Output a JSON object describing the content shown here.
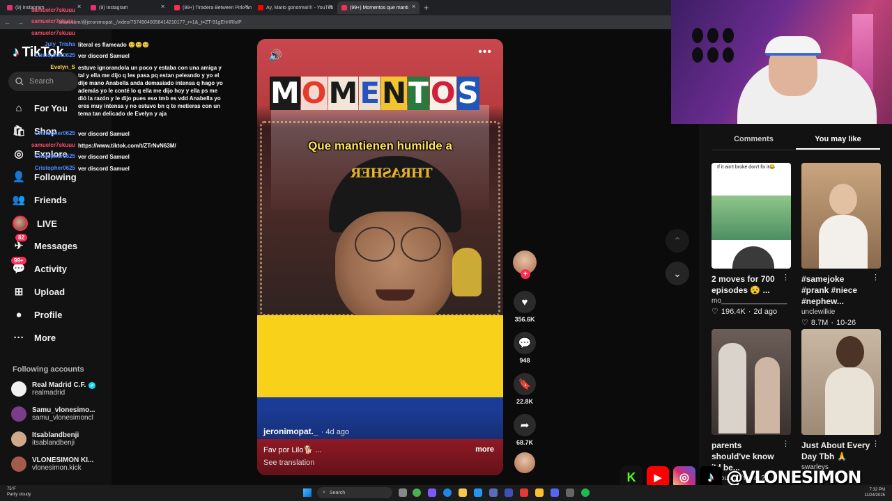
{
  "browser": {
    "tabs": [
      {
        "label": "(9) Instagram",
        "active": false,
        "color": "#e1306c"
      },
      {
        "label": "(9) Instagram",
        "active": false,
        "color": "#e1306c"
      },
      {
        "label": "(99+) Tiradera Between Pirlo an",
        "active": false,
        "color": "#fe2c55"
      },
      {
        "label": "Ay, Mario gonorrea!!!! - YouTub",
        "active": false,
        "color": "#ff0000"
      },
      {
        "label": "(99+) Momentos que manti",
        "active": true,
        "color": "#fe2c55"
      }
    ],
    "url": "tiktok.com/@jeronimopat._/video/7574904005841421017?_r=1&_t=ZT-91gEhHRlsIP"
  },
  "sidebar": {
    "logo": "TikTok",
    "search_placeholder": "Search",
    "items": [
      {
        "label": "For You",
        "icon": "home-icon"
      },
      {
        "label": "Shop",
        "icon": "shop-icon"
      },
      {
        "label": "Explore",
        "icon": "compass-icon"
      },
      {
        "label": "Following",
        "icon": "following-icon"
      },
      {
        "label": "Friends",
        "icon": "friends-icon"
      },
      {
        "label": "LIVE",
        "icon": "live-avatar"
      },
      {
        "label": "Messages",
        "icon": "messages-icon",
        "badge": "82"
      },
      {
        "label": "Activity",
        "icon": "activity-icon",
        "badge": "99+"
      },
      {
        "label": "Upload",
        "icon": "upload-icon"
      },
      {
        "label": "Profile",
        "icon": "profile-icon"
      },
      {
        "label": "More",
        "icon": "more-icon"
      }
    ],
    "following_title": "Following accounts",
    "accounts": [
      {
        "name": "Real Madrid C.F.",
        "user": "realmadrid",
        "verified": true,
        "color": "#f1f1f1"
      },
      {
        "name": "Samu_vlonesimo...",
        "user": "samu_vlonesimoncl",
        "verified": false,
        "color": "#7a3d8a"
      },
      {
        "name": "Itsablandbenji",
        "user": "itsablandbenji",
        "verified": false,
        "color": "#cfa98a"
      },
      {
        "name": "VLONESIMON KI...",
        "user": "vlonesimon.kick",
        "verified": false,
        "color": "#a45b4c"
      }
    ]
  },
  "chat": [
    {
      "name": "samuelcr7skuuu",
      "color": "#ff4d6d",
      "text": ""
    },
    {
      "name": "samuelcr7skuuu",
      "color": "#ff4d6d",
      "text": ""
    },
    {
      "name": "samuelcr7skuuu",
      "color": "#ff4d6d",
      "text": ""
    },
    {
      "name": "July_Trisha",
      "color": "#4d8bff",
      "text": "literal es flameado 🥺🥺🥺"
    },
    {
      "name": "Cristopher0625",
      "color": "#4d8bff",
      "text": "ver discord Samuel"
    },
    {
      "name": "Evelyn_S",
      "color": "#ffd24d",
      "text": "estuve ignorandola un poco y estaba con una amiga y tal y ella me dijo q les pasa pq estan peleando y yo el dije mano Anabella anda demasiado intensa q hago yo además yo le conté lo q ella me dijo hoy y ella ps me dió la razón y le dijo pues eso tmb es vdd Anabella yo eres muy intensa y no estuvo bn q te metieras con un tema tan delicado de Evelyn y aja"
    },
    {
      "name": "Cristopher0625",
      "color": "#4d8bff",
      "text": "ver discord Samuel"
    },
    {
      "name": "samuelcr7skuuu",
      "color": "#ff4d6d",
      "text": "https://www.tiktok.com/t/ZTrNvN63M/"
    },
    {
      "name": "Cristopher0625",
      "color": "#4d8bff",
      "text": "ver discord Samuel"
    },
    {
      "name": "Cristopher0625",
      "color": "#4d8bff",
      "text": "ver discord Samuel"
    }
  ],
  "video": {
    "title_letters": [
      {
        "ch": "M",
        "fg": "#ffffff",
        "bg": "#1a1a1a"
      },
      {
        "ch": "O",
        "fg": "#e33b2d",
        "bg": "#f3d9cf"
      },
      {
        "ch": "M",
        "fg": "#1a1a1a",
        "bg": "#f2e6d8"
      },
      {
        "ch": "E",
        "fg": "#2a52be",
        "bg": "#e9e2d0"
      },
      {
        "ch": "N",
        "fg": "#1a1a1a",
        "bg": "#f1c52f"
      },
      {
        "ch": "T",
        "fg": "#ffffff",
        "bg": "#2b7a3d"
      },
      {
        "ch": "O",
        "fg": "#d21f3c",
        "bg": "#f7f1e8"
      },
      {
        "ch": "S",
        "fg": "#ffffff",
        "bg": "#1f56b8"
      }
    ],
    "subtitle": "Que mantienen humilde a",
    "beanie_text": "THRASHER",
    "author": "jeronimopat._",
    "time_ago": "· 4d ago",
    "caption": "Fav por Lilo🐕 ...",
    "more": "more",
    "see_translation": "See translation"
  },
  "actions": {
    "likes": "356.6K",
    "comments": "948",
    "saves": "22.8K",
    "shares": "68.7K"
  },
  "right_panel": {
    "tabs": [
      {
        "label": "Comments",
        "active": false
      },
      {
        "label": "You may like",
        "active": true
      }
    ],
    "cards": [
      {
        "title": "2 moves for 700 episodes 😵 ...",
        "user": "mo_________________",
        "likes": "196.4K",
        "date": "2d ago",
        "overlay": "If it ain't broke don't fix it😂"
      },
      {
        "title": "#samejoke #prank #niece #nephew...",
        "user": "unclewilkie",
        "likes": "8.7M",
        "date": "10-26",
        "overlay": ""
      },
      {
        "title": "parents should've know i'd be...",
        "user": "idyoufindthisacc?",
        "likes": "",
        "date": "",
        "overlay": ""
      },
      {
        "title": "Just About Every Day Tbh 🙏",
        "user": "swarleys",
        "likes": "",
        "date": "",
        "overlay": ""
      }
    ]
  },
  "overlay": {
    "handle": "@VLONESIMON"
  },
  "taskbar": {
    "weather_temp": "75°F",
    "weather_desc": "Partly cloudy",
    "search": "Search",
    "time": "7:32 PM",
    "date": "11/24/2025"
  }
}
